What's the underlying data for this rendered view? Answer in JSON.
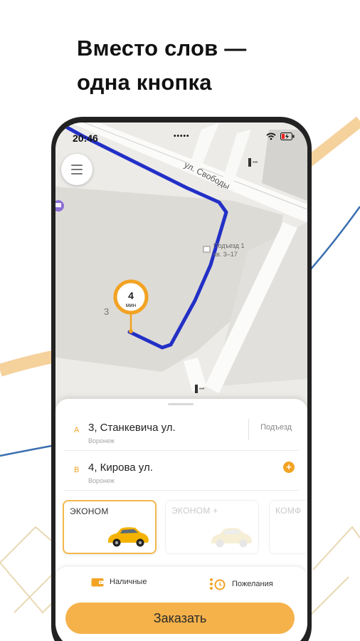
{
  "headline": {
    "line1": "Вместо слов —",
    "line2": "одна кнопка"
  },
  "status_bar": {
    "time": "20:46",
    "notch": "•••••"
  },
  "map": {
    "street_label": "ул. Свободы",
    "entrance_title": "Подъезд 1",
    "entrance_apts": "кв. 3–17",
    "house_number": "3",
    "eta_value": "4",
    "eta_unit": "мин",
    "route_color": "#2330c6",
    "accent_color": "#f2a324"
  },
  "addresses": [
    {
      "letter": "А",
      "street": "3, Станкевича ул.",
      "city": "Воронеж",
      "extra": "Подъезд"
    },
    {
      "letter": "В",
      "street": "4, Кирова ул.",
      "city": "Воронеж",
      "action": "+"
    }
  ],
  "tariffs": [
    {
      "name": "ЭКОНОМ",
      "selected": true
    },
    {
      "name": "ЭКОНОМ +",
      "selected": false
    },
    {
      "name": "КОМФ",
      "selected": false
    }
  ],
  "options": {
    "payment": "Наличные",
    "wishes": "Пожелания"
  },
  "order_button": "Заказать",
  "colors": {
    "accent": "#f2a324",
    "button": "#f5b24b",
    "route": "#2330c6"
  }
}
